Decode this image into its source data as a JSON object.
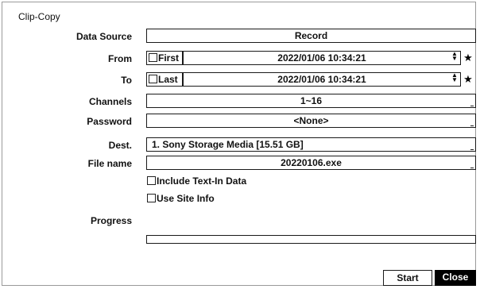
{
  "dialog": {
    "title": "Clip-Copy"
  },
  "data_source": {
    "label": "Data Source",
    "value": "Record"
  },
  "from": {
    "label": "From",
    "checkbox_label": "First",
    "datetime": "2022/01/06  10:34:21"
  },
  "to": {
    "label": "To",
    "checkbox_label": "Last",
    "datetime": "2022/01/06  10:34:21"
  },
  "channels": {
    "label": "Channels",
    "value": "1~16"
  },
  "password": {
    "label": "Password",
    "value": "<None>"
  },
  "dest": {
    "label": "Dest.",
    "value": "1. Sony Storage Media [15.51 GB]"
  },
  "file_name": {
    "label": "File name",
    "value": "20220106.exe"
  },
  "options": {
    "include_text_in": "Include Text-In Data",
    "use_site_info": "Use Site Info"
  },
  "progress": {
    "label": "Progress",
    "value_percent": 0
  },
  "buttons": {
    "start": "Start",
    "close": "Close"
  },
  "icons": {
    "spinner": "spinner-icon",
    "star": "star-icon"
  },
  "colors": {
    "close_bg": "#000000",
    "close_fg": "#ffffff",
    "border": "#1a1a1a"
  }
}
